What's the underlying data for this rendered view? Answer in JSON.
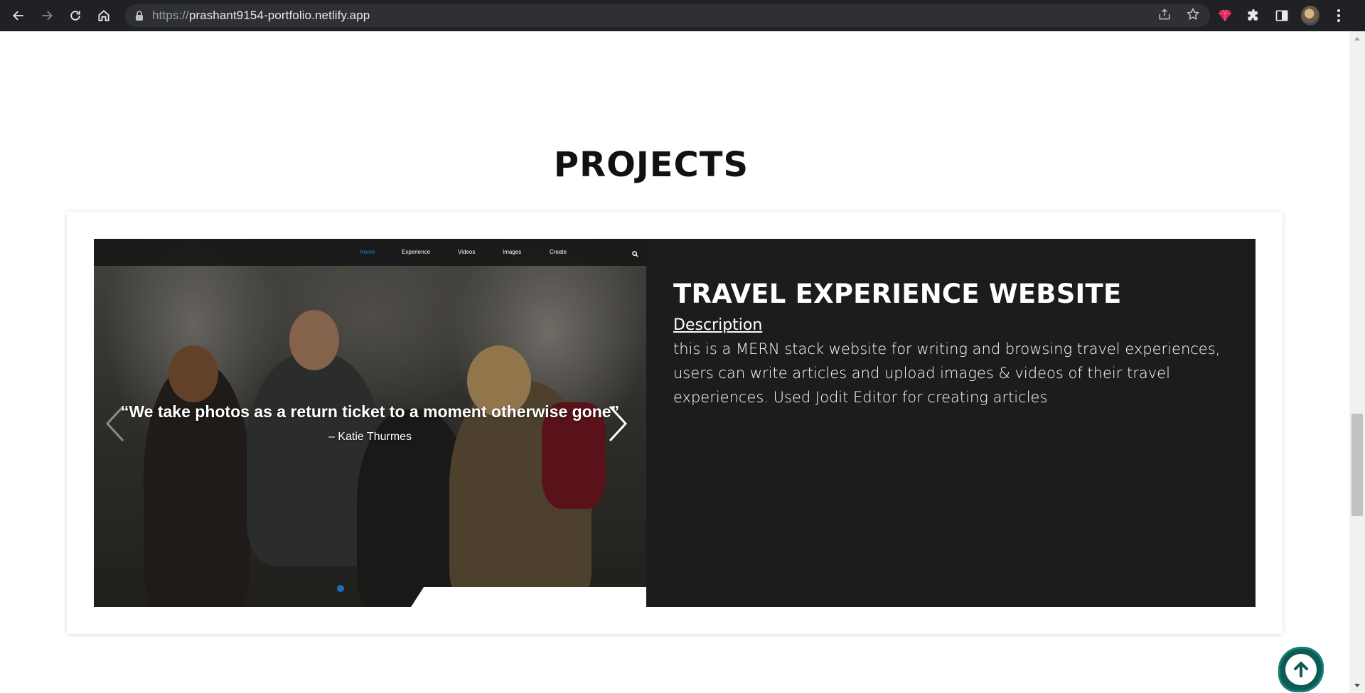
{
  "browser": {
    "url_scheme": "https://",
    "url_host": "prashant9154-portfolio.netlify.app"
  },
  "page": {
    "section_title": "PROJECTS"
  },
  "project": {
    "title": "TRAVEL EXPERIENCE WEBSITE",
    "description_label": "Description",
    "description": "this is a MERN stack website for writing and browsing travel experiences, users can write articles and upload images & videos of their travel experiences. Used Jodit Editor for creating articles",
    "preview": {
      "nav": [
        "Home",
        "Experience",
        "Videos",
        "Images",
        "Create"
      ],
      "active_nav": "Home",
      "quote": "“We take photos as a return ticket to a moment otherwise gone”",
      "quote_author": "– Katie Thurmes",
      "slide_count": 1
    }
  },
  "colors": {
    "accent_teal": "#0e5a55",
    "active_link": "#1c8fb7",
    "panel_bg": "#1c1c1c"
  }
}
